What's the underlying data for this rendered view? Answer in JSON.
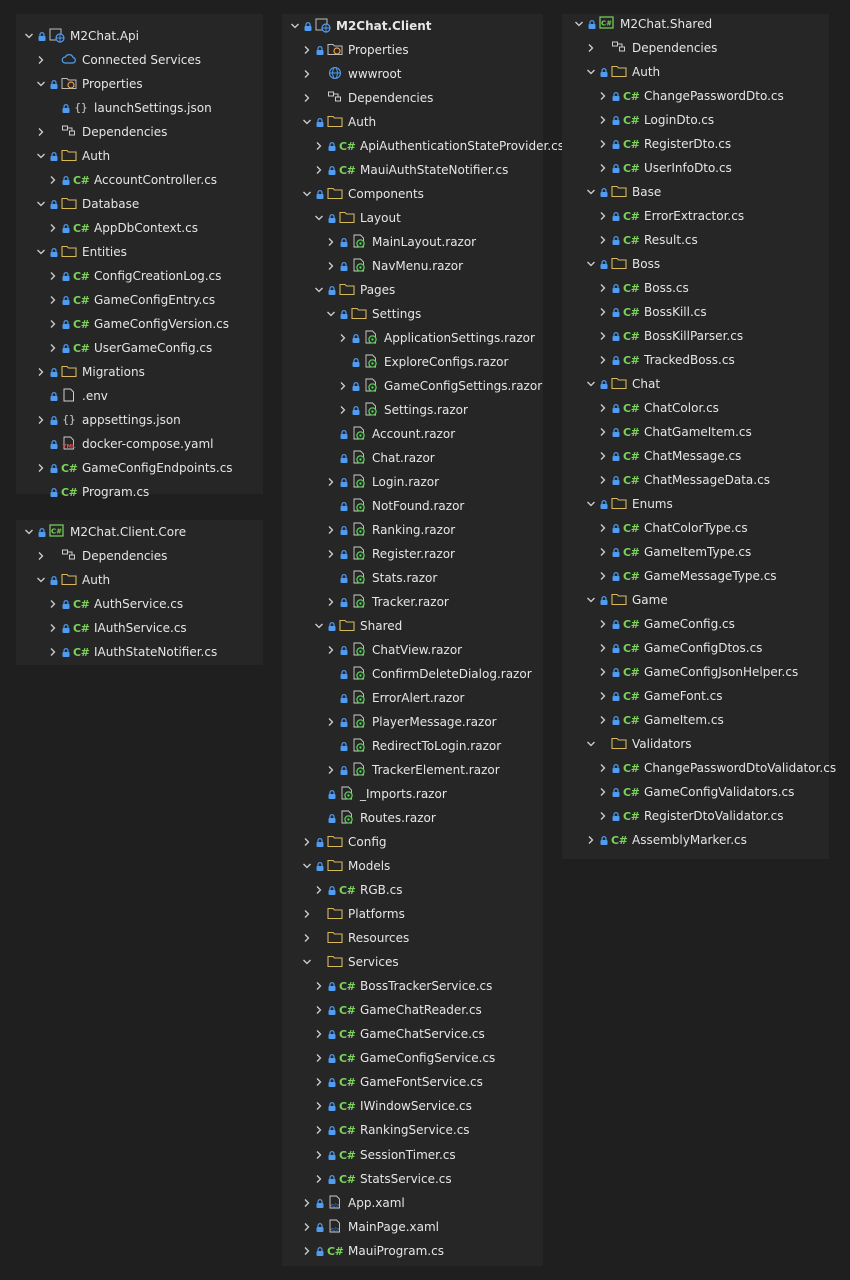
{
  "colors": {
    "background": "#1f1f1f",
    "panel": "#262626",
    "text": "#e6e6e6",
    "folder": "#d9b85a",
    "csharp": "#7ad35a",
    "lock": "#4f9cf0",
    "razor": "#5fc65a"
  },
  "panels": [
    {
      "id": "api",
      "items": [
        {
          "d": 0,
          "c": "open",
          "lock": 1,
          "icon": "proj",
          "label": "M2Chat.Api"
        },
        {
          "d": 1,
          "c": "closed",
          "lock": 0,
          "icon": "services",
          "label": "Connected Services"
        },
        {
          "d": 1,
          "c": "open",
          "lock": 1,
          "icon": "props",
          "label": "Properties"
        },
        {
          "d": 2,
          "c": "none",
          "lock": 1,
          "icon": "json",
          "label": "launchSettings.json"
        },
        {
          "d": 1,
          "c": "closed",
          "lock": 0,
          "icon": "deps",
          "label": "Dependencies"
        },
        {
          "d": 1,
          "c": "open",
          "lock": 1,
          "icon": "folder",
          "label": "Auth"
        },
        {
          "d": 2,
          "c": "closed",
          "lock": 1,
          "icon": "cs",
          "label": "AccountController.cs"
        },
        {
          "d": 1,
          "c": "open",
          "lock": 1,
          "icon": "folder",
          "label": "Database"
        },
        {
          "d": 2,
          "c": "closed",
          "lock": 1,
          "icon": "cs",
          "label": "AppDbContext.cs"
        },
        {
          "d": 1,
          "c": "open",
          "lock": 1,
          "icon": "folder",
          "label": "Entities"
        },
        {
          "d": 2,
          "c": "closed",
          "lock": 1,
          "icon": "cs",
          "label": "ConfigCreationLog.cs"
        },
        {
          "d": 2,
          "c": "closed",
          "lock": 1,
          "icon": "cs",
          "label": "GameConfigEntry.cs"
        },
        {
          "d": 2,
          "c": "closed",
          "lock": 1,
          "icon": "cs",
          "label": "GameConfigVersion.cs"
        },
        {
          "d": 2,
          "c": "closed",
          "lock": 1,
          "icon": "cs",
          "label": "UserGameConfig.cs"
        },
        {
          "d": 1,
          "c": "closed",
          "lock": 1,
          "icon": "folder",
          "label": "Migrations"
        },
        {
          "d": 1,
          "c": "none",
          "lock": 1,
          "icon": "file",
          "label": ".env"
        },
        {
          "d": 1,
          "c": "closed",
          "lock": 1,
          "icon": "json",
          "label": "appsettings.json"
        },
        {
          "d": 1,
          "c": "none",
          "lock": 1,
          "icon": "yaml",
          "label": "docker-compose.yaml"
        },
        {
          "d": 1,
          "c": "closed",
          "lock": 1,
          "icon": "cs",
          "label": "GameConfigEndpoints.cs"
        },
        {
          "d": 1,
          "c": "none",
          "lock": 1,
          "icon": "cs",
          "label": "Program.cs"
        }
      ]
    },
    {
      "id": "core",
      "items": [
        {
          "d": 0,
          "c": "open",
          "lock": 1,
          "icon": "cslib",
          "label": "M2Chat.Client.Core"
        },
        {
          "d": 1,
          "c": "closed",
          "lock": 0,
          "icon": "deps",
          "label": "Dependencies"
        },
        {
          "d": 1,
          "c": "open",
          "lock": 1,
          "icon": "folder",
          "label": "Auth"
        },
        {
          "d": 2,
          "c": "closed",
          "lock": 1,
          "icon": "cs",
          "label": "AuthService.cs"
        },
        {
          "d": 2,
          "c": "closed",
          "lock": 1,
          "icon": "cs",
          "label": "IAuthService.cs"
        },
        {
          "d": 2,
          "c": "closed",
          "lock": 1,
          "icon": "cs",
          "label": "IAuthStateNotifier.cs"
        }
      ]
    },
    {
      "id": "client",
      "items": [
        {
          "d": 0,
          "c": "open",
          "lock": 1,
          "icon": "proj",
          "label": "M2Chat.Client",
          "bold": true
        },
        {
          "d": 1,
          "c": "closed",
          "lock": 1,
          "icon": "props",
          "label": "Properties"
        },
        {
          "d": 1,
          "c": "closed",
          "lock": 0,
          "icon": "globe",
          "label": "wwwroot"
        },
        {
          "d": 1,
          "c": "closed",
          "lock": 0,
          "icon": "deps",
          "label": "Dependencies"
        },
        {
          "d": 1,
          "c": "open",
          "lock": 1,
          "icon": "folder",
          "label": "Auth"
        },
        {
          "d": 2,
          "c": "closed",
          "lock": 1,
          "icon": "cs",
          "label": "ApiAuthenticationStateProvider.cs"
        },
        {
          "d": 2,
          "c": "closed",
          "lock": 1,
          "icon": "cs",
          "label": "MauiAuthStateNotifier.cs"
        },
        {
          "d": 1,
          "c": "open",
          "lock": 1,
          "icon": "folder",
          "label": "Components"
        },
        {
          "d": 2,
          "c": "open",
          "lock": 1,
          "icon": "folder",
          "label": "Layout"
        },
        {
          "d": 3,
          "c": "closed",
          "lock": 1,
          "icon": "razor",
          "label": "MainLayout.razor"
        },
        {
          "d": 3,
          "c": "closed",
          "lock": 1,
          "icon": "razor",
          "label": "NavMenu.razor"
        },
        {
          "d": 2,
          "c": "open",
          "lock": 1,
          "icon": "folder",
          "label": "Pages"
        },
        {
          "d": 3,
          "c": "open",
          "lock": 1,
          "icon": "folder",
          "label": "Settings"
        },
        {
          "d": 4,
          "c": "closed",
          "lock": 1,
          "icon": "razor",
          "label": "ApplicationSettings.razor"
        },
        {
          "d": 4,
          "c": "none",
          "lock": 1,
          "icon": "razor",
          "label": "ExploreConfigs.razor"
        },
        {
          "d": 4,
          "c": "closed",
          "lock": 1,
          "icon": "razor",
          "label": "GameConfigSettings.razor"
        },
        {
          "d": 4,
          "c": "closed",
          "lock": 1,
          "icon": "razor",
          "label": "Settings.razor"
        },
        {
          "d": 3,
          "c": "none",
          "lock": 1,
          "icon": "razor",
          "label": "Account.razor"
        },
        {
          "d": 3,
          "c": "none",
          "lock": 1,
          "icon": "razor",
          "label": "Chat.razor"
        },
        {
          "d": 3,
          "c": "closed",
          "lock": 1,
          "icon": "razor",
          "label": "Login.razor"
        },
        {
          "d": 3,
          "c": "none",
          "lock": 1,
          "icon": "razor",
          "label": "NotFound.razor"
        },
        {
          "d": 3,
          "c": "closed",
          "lock": 1,
          "icon": "razor",
          "label": "Ranking.razor"
        },
        {
          "d": 3,
          "c": "closed",
          "lock": 1,
          "icon": "razor",
          "label": "Register.razor"
        },
        {
          "d": 3,
          "c": "none",
          "lock": 1,
          "icon": "razor",
          "label": "Stats.razor"
        },
        {
          "d": 3,
          "c": "closed",
          "lock": 1,
          "icon": "razor",
          "label": "Tracker.razor"
        },
        {
          "d": 2,
          "c": "open",
          "lock": 1,
          "icon": "folder",
          "label": "Shared"
        },
        {
          "d": 3,
          "c": "closed",
          "lock": 1,
          "icon": "razor",
          "label": "ChatView.razor"
        },
        {
          "d": 3,
          "c": "none",
          "lock": 1,
          "icon": "razor",
          "label": "ConfirmDeleteDialog.razor"
        },
        {
          "d": 3,
          "c": "none",
          "lock": 1,
          "icon": "razor",
          "label": "ErrorAlert.razor"
        },
        {
          "d": 3,
          "c": "closed",
          "lock": 1,
          "icon": "razor",
          "label": "PlayerMessage.razor"
        },
        {
          "d": 3,
          "c": "none",
          "lock": 1,
          "icon": "razor",
          "label": "RedirectToLogin.razor"
        },
        {
          "d": 3,
          "c": "closed",
          "lock": 1,
          "icon": "razor",
          "label": "TrackerElement.razor"
        },
        {
          "d": 2,
          "c": "none",
          "lock": 1,
          "icon": "razor",
          "label": "_Imports.razor"
        },
        {
          "d": 2,
          "c": "none",
          "lock": 1,
          "icon": "razor",
          "label": "Routes.razor"
        },
        {
          "d": 1,
          "c": "closed",
          "lock": 1,
          "icon": "folder",
          "label": "Config"
        },
        {
          "d": 1,
          "c": "open",
          "lock": 1,
          "icon": "folder",
          "label": "Models"
        },
        {
          "d": 2,
          "c": "closed",
          "lock": 1,
          "icon": "cs",
          "label": "RGB.cs"
        },
        {
          "d": 1,
          "c": "closed",
          "lock": 0,
          "icon": "folder",
          "label": "Platforms"
        },
        {
          "d": 1,
          "c": "closed",
          "lock": 0,
          "icon": "folder",
          "label": "Resources"
        },
        {
          "d": 1,
          "c": "open",
          "lock": 0,
          "icon": "folder",
          "label": "Services"
        },
        {
          "d": 2,
          "c": "closed",
          "lock": 1,
          "icon": "cs",
          "label": "BossTrackerService.cs"
        },
        {
          "d": 2,
          "c": "closed",
          "lock": 1,
          "icon": "cs",
          "label": "GameChatReader.cs"
        },
        {
          "d": 2,
          "c": "closed",
          "lock": 1,
          "icon": "cs",
          "label": "GameChatService.cs"
        },
        {
          "d": 2,
          "c": "closed",
          "lock": 1,
          "icon": "cs",
          "label": "GameConfigService.cs"
        },
        {
          "d": 2,
          "c": "closed",
          "lock": 1,
          "icon": "cs",
          "label": "GameFontService.cs"
        },
        {
          "d": 2,
          "c": "closed",
          "lock": 1,
          "icon": "cs",
          "label": "IWindowService.cs"
        },
        {
          "d": 2,
          "c": "closed",
          "lock": 1,
          "icon": "cs",
          "label": "RankingService.cs"
        },
        {
          "d": 2,
          "c": "closed",
          "lock": 1,
          "icon": "cs",
          "label": "SessionTimer.cs"
        },
        {
          "d": 2,
          "c": "closed",
          "lock": 1,
          "icon": "cs",
          "label": "StatsService.cs"
        },
        {
          "d": 1,
          "c": "closed",
          "lock": 1,
          "icon": "xaml",
          "label": "App.xaml"
        },
        {
          "d": 1,
          "c": "closed",
          "lock": 1,
          "icon": "xaml",
          "label": "MainPage.xaml"
        },
        {
          "d": 1,
          "c": "closed",
          "lock": 1,
          "icon": "cs",
          "label": "MauiProgram.cs"
        }
      ]
    },
    {
      "id": "shared",
      "items": [
        {
          "d": 0,
          "c": "open",
          "lock": 1,
          "icon": "cslib",
          "label": "M2Chat.Shared"
        },
        {
          "d": 1,
          "c": "closed",
          "lock": 0,
          "icon": "deps",
          "label": "Dependencies"
        },
        {
          "d": 1,
          "c": "open",
          "lock": 1,
          "icon": "folder",
          "label": "Auth"
        },
        {
          "d": 2,
          "c": "closed",
          "lock": 1,
          "icon": "cs",
          "label": "ChangePasswordDto.cs"
        },
        {
          "d": 2,
          "c": "closed",
          "lock": 1,
          "icon": "cs",
          "label": "LoginDto.cs"
        },
        {
          "d": 2,
          "c": "closed",
          "lock": 1,
          "icon": "cs",
          "label": "RegisterDto.cs"
        },
        {
          "d": 2,
          "c": "closed",
          "lock": 1,
          "icon": "cs",
          "label": "UserInfoDto.cs"
        },
        {
          "d": 1,
          "c": "open",
          "lock": 1,
          "icon": "folder",
          "label": "Base"
        },
        {
          "d": 2,
          "c": "closed",
          "lock": 1,
          "icon": "cs",
          "label": "ErrorExtractor.cs"
        },
        {
          "d": 2,
          "c": "closed",
          "lock": 1,
          "icon": "cs",
          "label": "Result.cs"
        },
        {
          "d": 1,
          "c": "open",
          "lock": 1,
          "icon": "folder",
          "label": "Boss"
        },
        {
          "d": 2,
          "c": "closed",
          "lock": 1,
          "icon": "cs",
          "label": "Boss.cs"
        },
        {
          "d": 2,
          "c": "closed",
          "lock": 1,
          "icon": "cs",
          "label": "BossKill.cs"
        },
        {
          "d": 2,
          "c": "closed",
          "lock": 1,
          "icon": "cs",
          "label": "BossKillParser.cs"
        },
        {
          "d": 2,
          "c": "closed",
          "lock": 1,
          "icon": "cs",
          "label": "TrackedBoss.cs"
        },
        {
          "d": 1,
          "c": "open",
          "lock": 1,
          "icon": "folder",
          "label": "Chat"
        },
        {
          "d": 2,
          "c": "closed",
          "lock": 1,
          "icon": "cs",
          "label": "ChatColor.cs"
        },
        {
          "d": 2,
          "c": "closed",
          "lock": 1,
          "icon": "cs",
          "label": "ChatGameItem.cs"
        },
        {
          "d": 2,
          "c": "closed",
          "lock": 1,
          "icon": "cs",
          "label": "ChatMessage.cs"
        },
        {
          "d": 2,
          "c": "closed",
          "lock": 1,
          "icon": "cs",
          "label": "ChatMessageData.cs"
        },
        {
          "d": 1,
          "c": "open",
          "lock": 1,
          "icon": "folder",
          "label": "Enums"
        },
        {
          "d": 2,
          "c": "closed",
          "lock": 1,
          "icon": "cs",
          "label": "ChatColorType.cs"
        },
        {
          "d": 2,
          "c": "closed",
          "lock": 1,
          "icon": "cs",
          "label": "GameItemType.cs"
        },
        {
          "d": 2,
          "c": "closed",
          "lock": 1,
          "icon": "cs",
          "label": "GameMessageType.cs"
        },
        {
          "d": 1,
          "c": "open",
          "lock": 1,
          "icon": "folder",
          "label": "Game"
        },
        {
          "d": 2,
          "c": "closed",
          "lock": 1,
          "icon": "cs",
          "label": "GameConfig.cs"
        },
        {
          "d": 2,
          "c": "closed",
          "lock": 1,
          "icon": "cs",
          "label": "GameConfigDtos.cs"
        },
        {
          "d": 2,
          "c": "closed",
          "lock": 1,
          "icon": "cs",
          "label": "GameConfigJsonHelper.cs"
        },
        {
          "d": 2,
          "c": "closed",
          "lock": 1,
          "icon": "cs",
          "label": "GameFont.cs"
        },
        {
          "d": 2,
          "c": "closed",
          "lock": 1,
          "icon": "cs",
          "label": "GameItem.cs"
        },
        {
          "d": 1,
          "c": "open",
          "lock": 0,
          "icon": "folder",
          "label": "Validators"
        },
        {
          "d": 2,
          "c": "closed",
          "lock": 1,
          "icon": "cs",
          "label": "ChangePasswordDtoValidator.cs"
        },
        {
          "d": 2,
          "c": "closed",
          "lock": 1,
          "icon": "cs",
          "label": "GameConfigValidators.cs"
        },
        {
          "d": 2,
          "c": "closed",
          "lock": 1,
          "icon": "cs",
          "label": "RegisterDtoValidator.cs"
        },
        {
          "d": 1,
          "c": "closed",
          "lock": 1,
          "icon": "cs",
          "label": "AssemblyMarker.cs"
        }
      ]
    }
  ]
}
